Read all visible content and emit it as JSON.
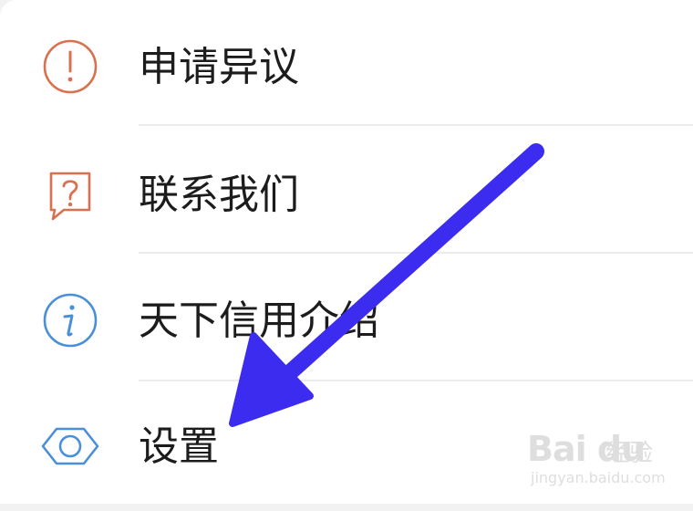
{
  "menu": {
    "items": [
      {
        "label": "申请异议",
        "icon": "exclamation-circle-icon",
        "icon_color": "#d9714f"
      },
      {
        "label": "联系我们",
        "icon": "question-bubble-icon",
        "icon_color": "#d9714f"
      },
      {
        "label": "天下信用介绍",
        "icon": "info-circle-icon",
        "icon_color": "#4a8fd9"
      },
      {
        "label": "设置",
        "icon": "hexagon-settings-icon",
        "icon_color": "#4a8fd9"
      }
    ]
  },
  "annotation": {
    "arrow_color": "#3b2cf0"
  },
  "watermark": {
    "brand": "Bai du",
    "cn": "经验",
    "url": "jingyan.baidu.com"
  }
}
